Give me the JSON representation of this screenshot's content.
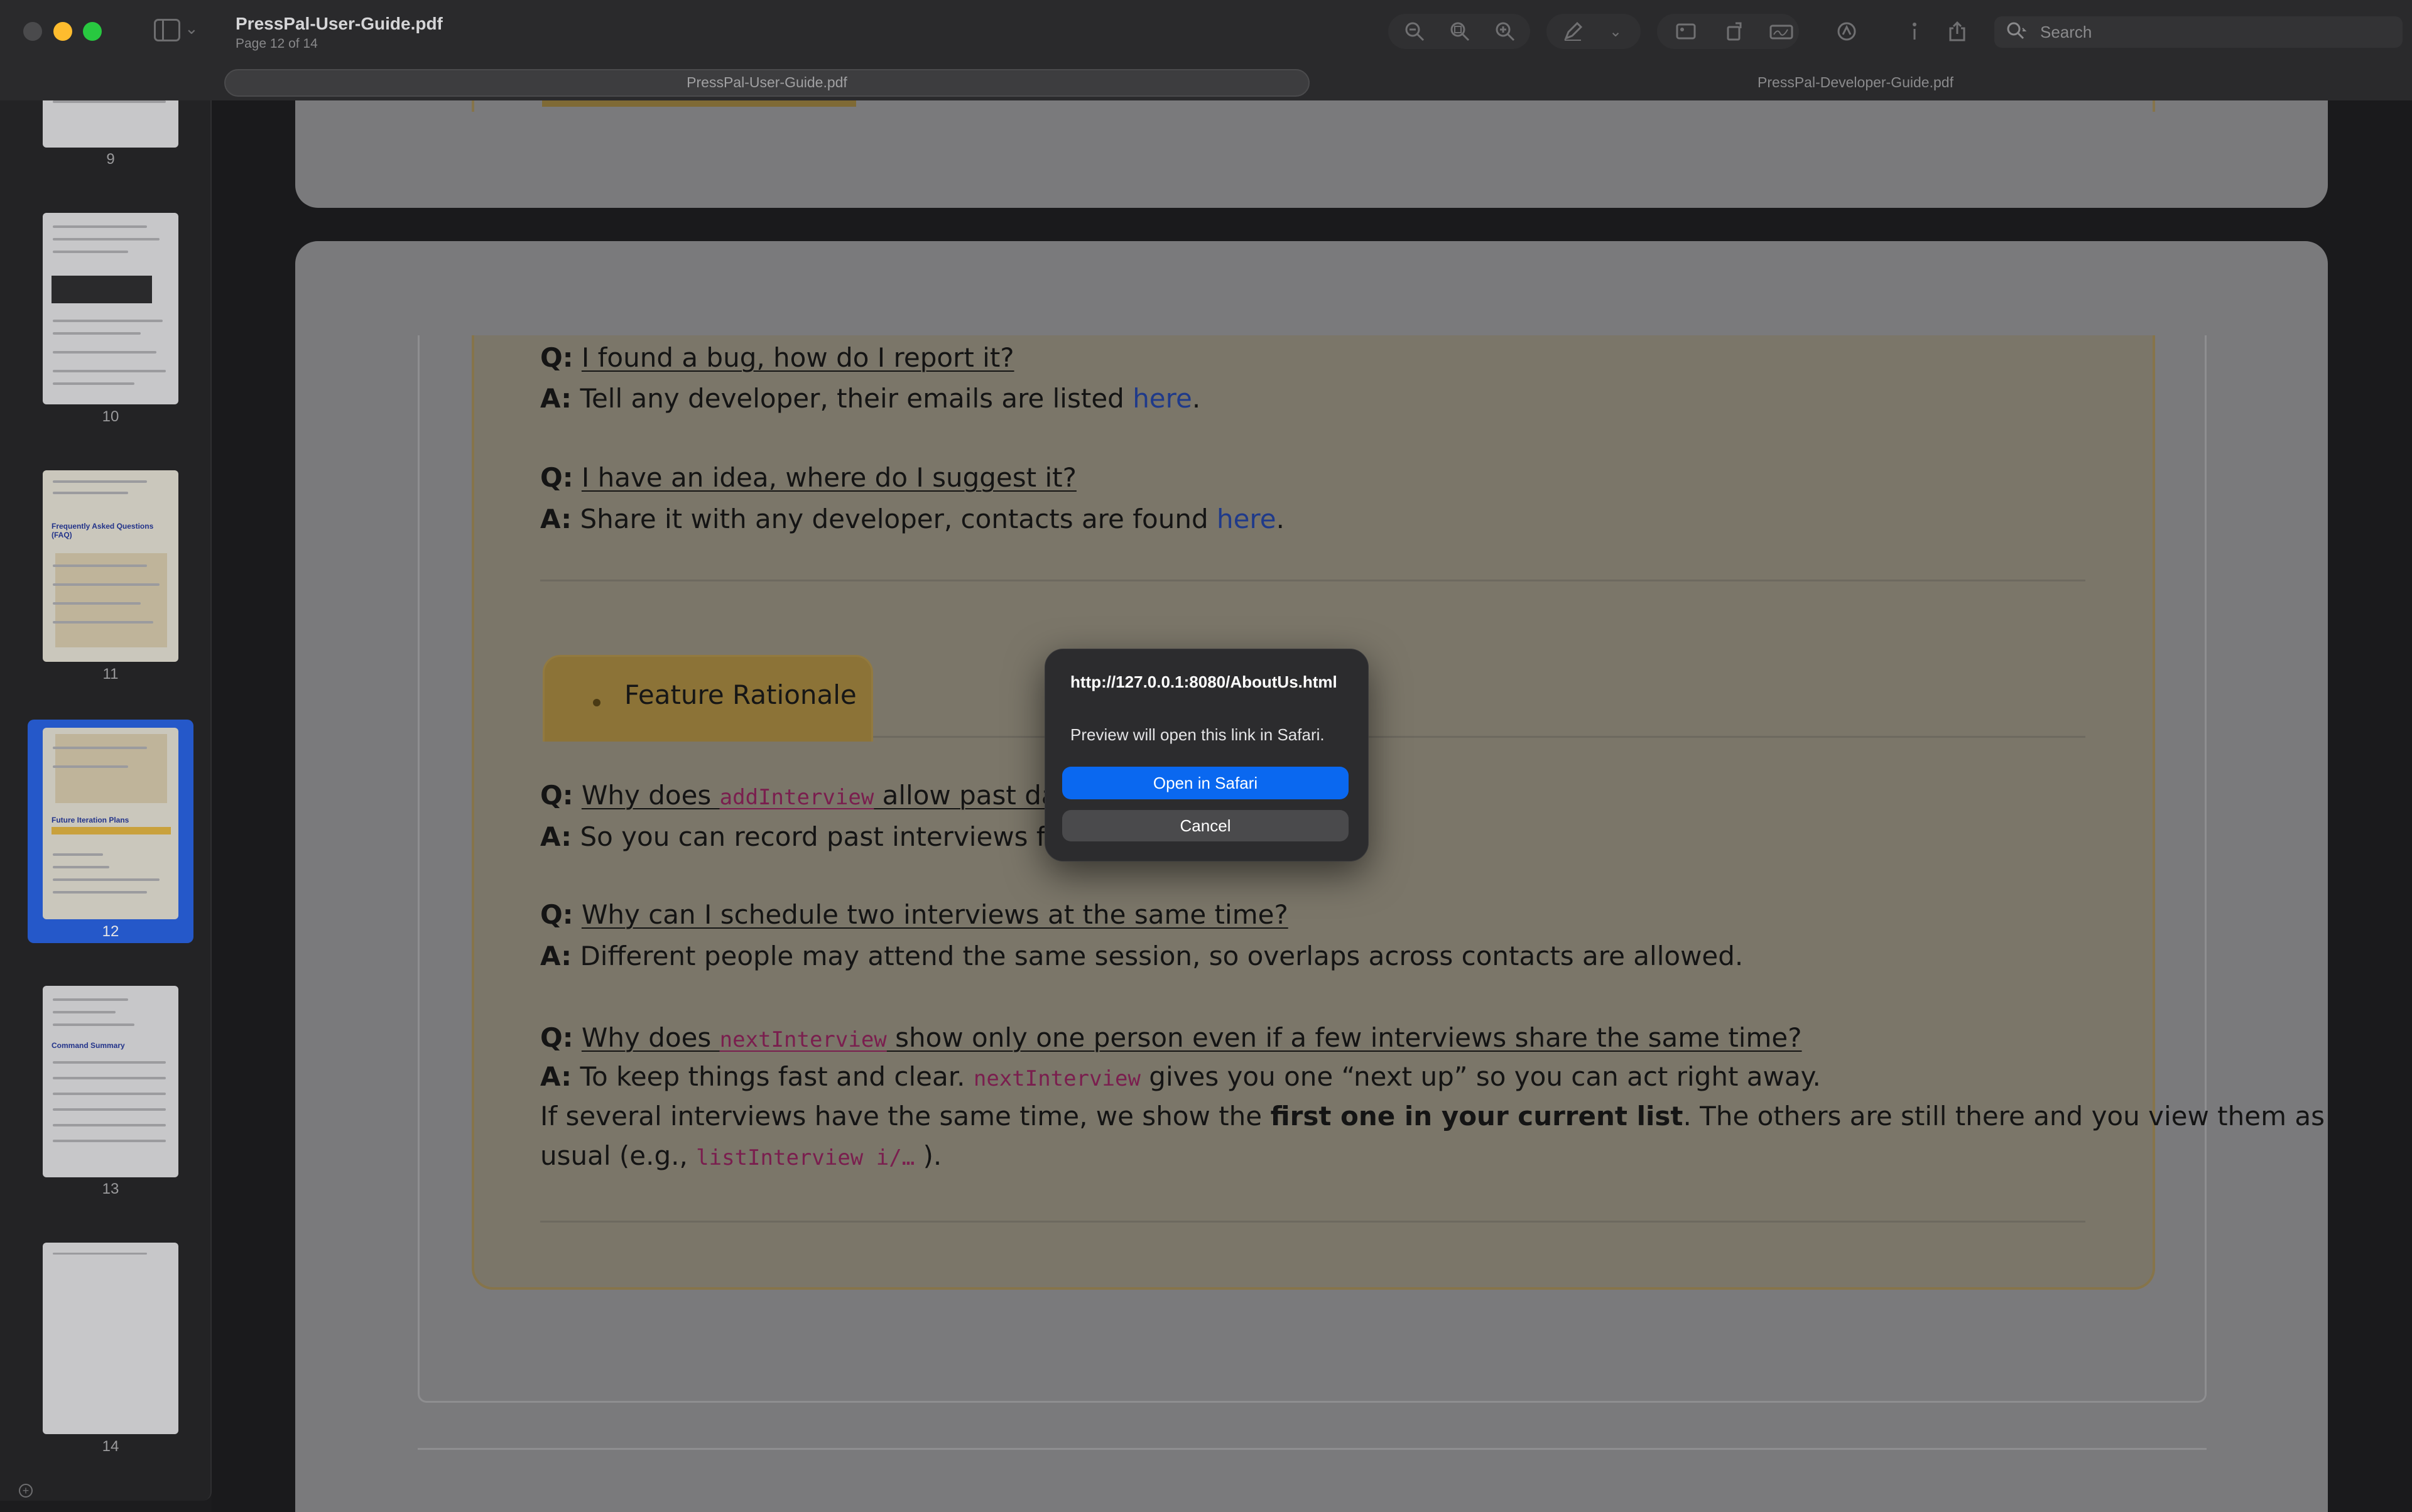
{
  "window": {
    "title": "PressPal-User-Guide.pdf",
    "subtitle": "Page 12 of 14"
  },
  "toolbar": {
    "icons": [
      "zoom-out-icon",
      "zoom-fit-icon",
      "zoom-in-icon",
      "markup-pen-icon",
      "chevron-down-icon",
      "crop-icon",
      "rotate-icon",
      "signature-icon",
      "annotate-icon",
      "info-icon",
      "share-icon"
    ],
    "search_placeholder": "Search"
  },
  "tabs": [
    {
      "label": "PressPal-User-Guide.pdf",
      "active": true
    },
    {
      "label": "PressPal-Developer-Guide.pdf",
      "active": false
    }
  ],
  "sidebar": {
    "thumbnails": [
      {
        "page": "9",
        "heading": ""
      },
      {
        "page": "10",
        "heading": ""
      },
      {
        "page": "11",
        "heading": "Frequently Asked Questions (FAQ)"
      },
      {
        "page": "12",
        "heading": "Future Iteration Plans",
        "selected": true
      },
      {
        "page": "13",
        "heading": "Command Summary"
      },
      {
        "page": "14",
        "heading": ""
      }
    ]
  },
  "document": {
    "qa": [
      {
        "q_prefix": "Q:",
        "q": "I found a bug, how do I report it?",
        "a_prefix": "A:",
        "a": "Tell any developer, their emails are listed ",
        "a_link": "here",
        "a_end": "."
      },
      {
        "q_prefix": "Q:",
        "q": "I have an idea, where do I suggest it?",
        "a_prefix": "A:",
        "a": "Share it with any developer, contacts are found ",
        "a_link": "here",
        "a_end": "."
      }
    ],
    "section_title": "Feature Rationale",
    "rationale": {
      "q1_pre": "Why does ",
      "q1_code": "addInterview",
      "q1_post": " allow past dat",
      "a1": "So you can record past interviews for ref",
      "q2": "Why can I schedule two interviews at the same time?",
      "a2": "Different people may attend the same session, so overlaps across contacts are allowed.",
      "q3_pre": "Why does ",
      "q3_code": "nextInterview",
      "q3_post": " show only one person even if a few interviews share the same time?",
      "a3_pre": "To keep things fast and clear. ",
      "a3_code": "nextInterview",
      "a3_post": " gives you one “next up” so you can act right away.",
      "a3_line2_pre": "If several interviews have the same time, we show the ",
      "a3_line2_bold": "first one in your current list",
      "a3_line2_post": ". The others are still there and you view them as",
      "a3_line3_pre": "usual (e.g., ",
      "a3_line3_code": "listInterview i/…",
      "a3_line3_post": " )."
    }
  },
  "dialog": {
    "url": "http://127.0.0.1:8080/AboutUs.html",
    "message": "Preview will open this link in Safari.",
    "primary_button": "Open in Safari",
    "cancel_button": "Cancel"
  },
  "colors": {
    "accent": "#0a68f0",
    "section_tag": "#8c7337",
    "code": "#7a1e4e",
    "link": "#1f3a8a"
  }
}
